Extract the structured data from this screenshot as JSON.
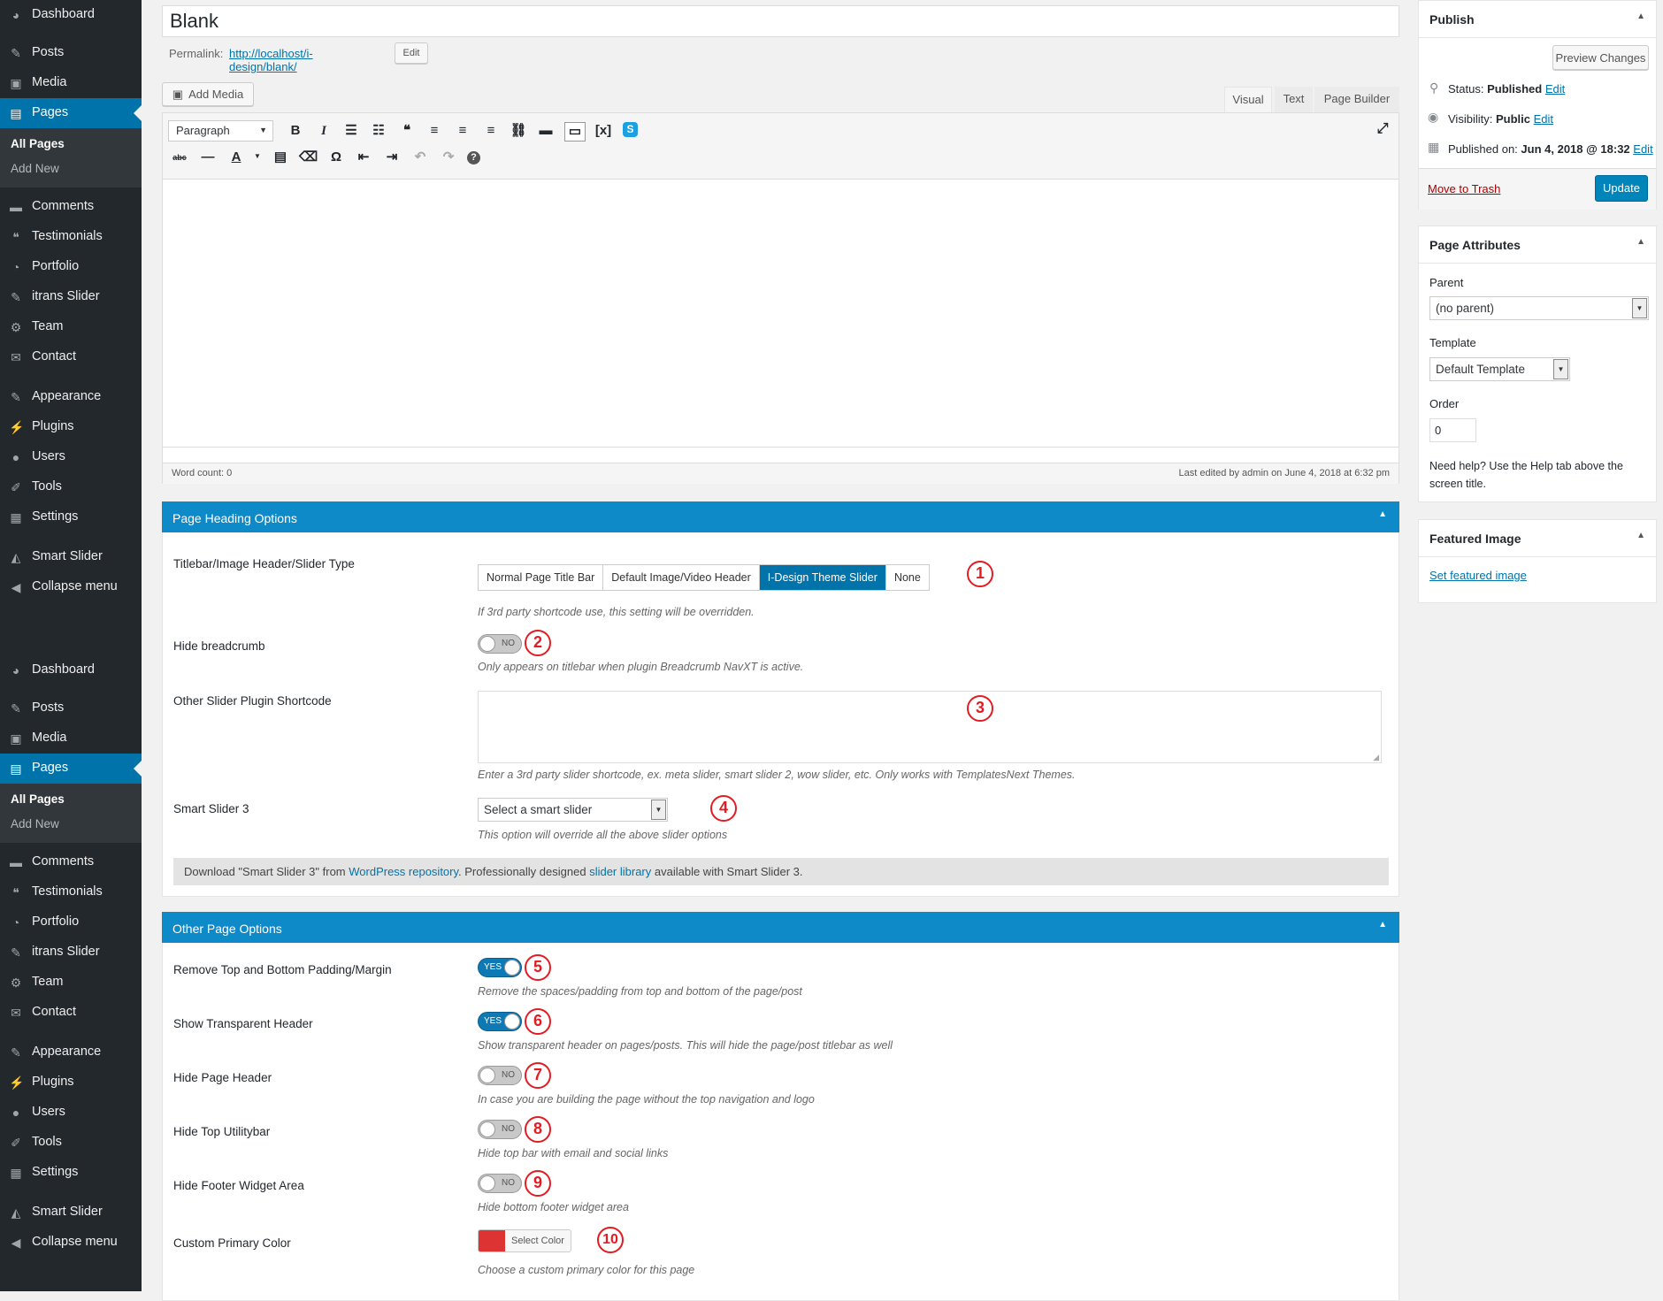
{
  "admin_menu": {
    "items": [
      {
        "label": "Dashboard",
        "icon": "dashboard-icon",
        "glyph": "◕"
      },
      {
        "label": "Posts",
        "icon": "pushpin-icon",
        "glyph": "✎"
      },
      {
        "label": "Media",
        "icon": "media-icon",
        "glyph": "▣"
      },
      {
        "label": "Pages",
        "icon": "pages-icon",
        "glyph": "▤"
      },
      {
        "label": "Comments",
        "icon": "comments-icon",
        "glyph": "▬"
      },
      {
        "label": "Testimonials",
        "icon": "quote-icon",
        "glyph": "❝"
      },
      {
        "label": "Portfolio",
        "icon": "portfolio-icon",
        "glyph": "◔"
      },
      {
        "label": "itrans Slider",
        "icon": "pushpin-icon",
        "glyph": "✎"
      },
      {
        "label": "Team",
        "icon": "team-icon",
        "glyph": "⚙"
      },
      {
        "label": "Contact",
        "icon": "mail-icon",
        "glyph": "✉"
      },
      {
        "label": "Appearance",
        "icon": "brush-icon",
        "glyph": "✎"
      },
      {
        "label": "Plugins",
        "icon": "plugin-icon",
        "glyph": "⚡"
      },
      {
        "label": "Users",
        "icon": "user-icon",
        "glyph": "●"
      },
      {
        "label": "Tools",
        "icon": "wrench-icon",
        "glyph": "✐"
      },
      {
        "label": "Settings",
        "icon": "settings-icon",
        "glyph": "▦"
      },
      {
        "label": "Smart Slider",
        "icon": "slider-icon",
        "glyph": "◭"
      },
      {
        "label": "Collapse menu",
        "icon": "collapse-icon",
        "glyph": "◀"
      }
    ],
    "submenu": {
      "all_pages": "All Pages",
      "add_new": "Add New"
    }
  },
  "editor": {
    "title": "Blank",
    "permalink_label": "Permalink:",
    "permalink_url": "http://localhost/i-design/blank/",
    "permalink_edit": "Edit",
    "add_media": "Add Media",
    "tabs": {
      "visual": "Visual",
      "text": "Text",
      "page_builder": "Page Builder"
    },
    "format_select": "Paragraph",
    "word_count": "Word count: 0",
    "last_edited": "Last edited by admin on June 4, 2018 at 6:32 pm"
  },
  "page_heading": {
    "title": "Page Heading Options",
    "slider_type_label": "Titlebar/Image Header/Slider Type",
    "slider_type_options": [
      "Normal Page Title Bar",
      "Default Image/Video Header",
      "I-Design Theme Slider",
      "None"
    ],
    "slider_type_selected": "I-Design Theme Slider",
    "slider_type_desc": "If 3rd party shortcode use, this setting will be overridden.",
    "hide_breadcrumb_label": "Hide breadcrumb",
    "hide_breadcrumb_value": "NO",
    "hide_breadcrumb_desc": "Only appears on titlebar when plugin Breadcrumb NavXT is active.",
    "other_slider_label": "Other Slider Plugin Shortcode",
    "other_slider_desc": "Enter a 3rd party slider shortcode, ex. meta slider, smart slider 2, wow slider, etc. Only works with TemplatesNext Themes.",
    "smart_slider_label": "Smart Slider 3",
    "smart_slider_select": "Select a smart slider",
    "smart_slider_desc": "This option will override all the above slider options",
    "notice_pre": "Download \"Smart Slider 3\" from ",
    "notice_link1": "WordPress repository",
    "notice_mid": ". Professionally designed ",
    "notice_link2": "slider library",
    "notice_post": " available with Smart Slider 3."
  },
  "other_options": {
    "title": "Other Page Options",
    "rows": [
      {
        "label": "Remove Top and Bottom Padding/Margin",
        "value": "YES",
        "desc": "Remove the spaces/padding from top and bottom of the page/post",
        "num": "5"
      },
      {
        "label": "Show Transparent Header",
        "value": "YES",
        "desc": "Show transparent header on pages/posts. This will hide the page/post titlebar as well",
        "num": "6"
      },
      {
        "label": "Hide Page Header",
        "value": "NO",
        "desc": "In case you are building the page without the top navigation and logo",
        "num": "7"
      },
      {
        "label": "Hide Top Utilitybar",
        "value": "NO",
        "desc": "Hide top bar with email and social links",
        "num": "8"
      },
      {
        "label": "Hide Footer Widget Area",
        "value": "NO",
        "desc": "Hide bottom footer widget area",
        "num": "9"
      }
    ],
    "color_label": "Custom Primary Color",
    "color_button": "Select Color",
    "color_value": "#dd3333",
    "color_desc": "Choose a custom primary color for this page"
  },
  "annotations": [
    "1",
    "2",
    "3",
    "4",
    "5",
    "6",
    "7",
    "8",
    "9",
    "10"
  ],
  "publish": {
    "title": "Publish",
    "preview": "Preview Changes",
    "status_label": "Status: ",
    "status_value": "Published",
    "visibility_label": "Visibility: ",
    "visibility_value": "Public",
    "published_on_label": "Published on: ",
    "published_on_value": "Jun 4, 2018 @ 18:32",
    "edit": "Edit",
    "trash": "Move to Trash",
    "update": "Update"
  },
  "page_attributes": {
    "title": "Page Attributes",
    "parent_label": "Parent",
    "parent_value": "(no parent)",
    "template_label": "Template",
    "template_value": "Default Template",
    "order_label": "Order",
    "order_value": "0",
    "help": "Need help? Use the Help tab above the screen title."
  },
  "featured_image": {
    "title": "Featured Image",
    "link": "Set featured image"
  },
  "colors": {
    "accent": "#0073aa",
    "metabox_header": "#0e8ac9",
    "annotation": "#e31b23",
    "menu_bg": "#23282d"
  }
}
